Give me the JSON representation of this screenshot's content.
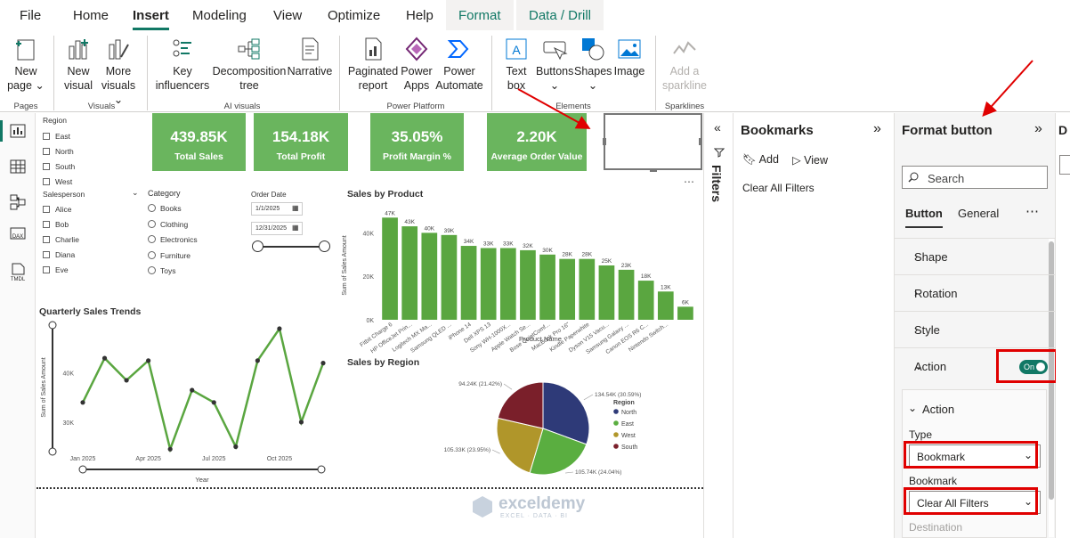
{
  "tabs": [
    {
      "label": "File"
    },
    {
      "label": "Home"
    },
    {
      "label": "Insert"
    },
    {
      "label": "Modeling"
    },
    {
      "label": "View"
    },
    {
      "label": "Optimize"
    },
    {
      "label": "Help"
    },
    {
      "label": "Format"
    },
    {
      "label": "Data / Drill"
    }
  ],
  "ribbon": {
    "new_page": "New page ⌄",
    "new_visual": "New visual",
    "more_visuals": "More visuals ⌄",
    "key_influencers": "Key influencers",
    "decomposition_tree": "Decomposition tree",
    "narrative": "Narrative",
    "paginated_report": "Paginated report",
    "power_apps": "Power Apps",
    "power_automate": "Power Automate",
    "text_box": "Text box",
    "buttons": "Buttons ⌄",
    "shapes": "Shapes ⌄",
    "image": "Image",
    "add_sparkline": "Add a sparkline",
    "groups": {
      "pages": "Pages",
      "visuals": "Visuals",
      "ai_visuals": "AI visuals",
      "power_platform": "Power Platform",
      "elements": "Elements",
      "sparklines": "Sparklines"
    }
  },
  "left_nav": [
    {
      "icon": "report-view-icon"
    },
    {
      "icon": "table-view-icon"
    },
    {
      "icon": "model-view-icon"
    },
    {
      "icon": "dax-query-icon",
      "label": "DAX"
    },
    {
      "icon": "tmdl-view-icon",
      "label": "TMDL"
    }
  ],
  "report": {
    "region_slicer": {
      "title": "Region",
      "items": [
        "East",
        "North",
        "South",
        "West"
      ]
    },
    "salesperson_slicer": {
      "title": "Salesperson",
      "items": [
        "Alice",
        "Bob",
        "Charlie",
        "Diana",
        "Eve"
      ]
    },
    "category_slicer": {
      "title": "Category",
      "items": [
        "Books",
        "Clothing",
        "Electronics",
        "Furniture",
        "Toys"
      ]
    },
    "order_date": {
      "title": "Order Date",
      "start": "1/1/2025",
      "end": "12/31/2025"
    },
    "kpis": [
      {
        "value": "439.85K",
        "label": "Total Sales"
      },
      {
        "value": "154.18K",
        "label": "Total Profit"
      },
      {
        "value": "35.05%",
        "label": "Profit Margin %"
      },
      {
        "value": "2.20K",
        "label": "Average Order Value"
      }
    ],
    "more_options": "⋯",
    "watermark": {
      "name": "exceldemy",
      "tagline": "EXCEL · DATA · BI"
    }
  },
  "chart_data": [
    {
      "type": "bar",
      "title": "Sales by Product",
      "xlabel": "Product Name",
      "ylabel": "Sum of Sales Amount",
      "yticks": [
        "0K",
        "20K",
        "40K"
      ],
      "ylim": [
        0,
        50
      ],
      "bar_color": "#5aa640",
      "categories": [
        "Fitbit Charge 6",
        "HP OfficeJet Prin...",
        "Logitech MX Ma...",
        "Samsung QLED ...",
        "iPhone 14",
        "Dell XPS 13",
        "Sony WH-1000X...",
        "Apple Watch Se...",
        "Bose QuietComf...",
        "MacBook Pro 16\"",
        "Kindle Paperwhite",
        "Dyson V15 Vacu...",
        "Samsung Galaxy ...",
        "Canon EOS R6 C...",
        "Nintendo Switch..."
      ],
      "values": [
        47,
        43,
        40,
        39,
        34,
        33,
        33,
        32,
        30,
        28,
        28,
        25,
        23,
        18,
        13,
        6
      ],
      "labels": [
        "47K",
        "43K",
        "40K",
        "39K",
        "34K",
        "33K",
        "33K",
        "32K",
        "30K",
        "28K",
        "28K",
        "25K",
        "23K",
        "18K",
        "13K",
        "6K"
      ]
    },
    {
      "type": "line",
      "title": "Quarterly Sales Trends",
      "xlabel": "Year",
      "ylabel": "Sum of Sales Amount",
      "xticks": [
        "Jan 2025",
        "Apr 2025",
        "Jul 2025",
        "Oct 2025"
      ],
      "yticks": [
        "30K",
        "40K"
      ],
      "ylim": [
        24,
        49
      ],
      "line_color": "#5aa640",
      "values": [
        34,
        43,
        38.5,
        42.5,
        24.5,
        36.5,
        34,
        25,
        42.5,
        49,
        30,
        42
      ]
    },
    {
      "type": "pie",
      "title": "Sales by Region",
      "legend_title": "Region",
      "legend_position": "right",
      "slices": [
        {
          "name": "North",
          "value": 134.54,
          "label": "134.54K (30.59%)",
          "color": "#2e3a78"
        },
        {
          "name": "East",
          "value": 105.74,
          "label": "105.74K (24.04%)",
          "color": "#5aae40"
        },
        {
          "name": "West",
          "value": 105.33,
          "label": "105.33K (23.95%)",
          "color": "#b0962a"
        },
        {
          "name": "South",
          "value": 94.24,
          "label": "94.24K (21.42%)",
          "color": "#7a1f2a"
        }
      ]
    }
  ],
  "filters": {
    "label": "Filters"
  },
  "bookmarks": {
    "title": "Bookmarks",
    "add": "Add",
    "view": "View",
    "items": [
      "Clear All Filters"
    ]
  },
  "format": {
    "title": "Format button",
    "search_placeholder": "Search",
    "tabs": [
      "Button",
      "General"
    ],
    "more": "⋯",
    "sections": [
      "Shape",
      "Rotation",
      "Style",
      "Action"
    ],
    "action_toggle": "On",
    "action_card": {
      "title": "Action",
      "type_label": "Type",
      "type_value": "Bookmark",
      "bookmark_label": "Bookmark",
      "bookmark_value": "Clear All Filters",
      "destination_label": "Destination"
    }
  },
  "extra_pane": {
    "title_initial": "D"
  },
  "colors": {
    "accent": "#117865",
    "kpi": "#6ab55e",
    "annotation": "#e00000"
  }
}
